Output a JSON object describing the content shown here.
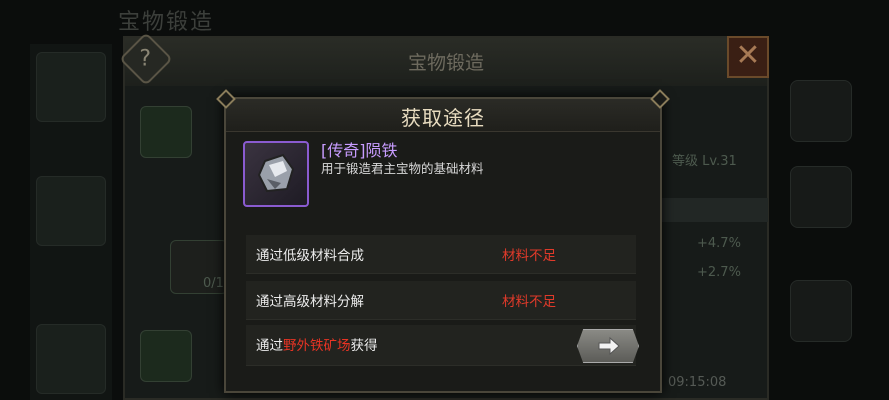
{
  "background": {
    "title": "宝物锻造",
    "panel_title": "宝物锻造",
    "help_label": "?",
    "close_label": "✕",
    "level_text": "等级 Lv.31",
    "stats": [
      "+4.7%",
      "+2.7%"
    ],
    "count_text": "0/1",
    "time": "09:15:08"
  },
  "dialog": {
    "title": "获取途径",
    "item": {
      "name": "[传奇]陨铁",
      "description": "用于锻造君主宝物的基础材料",
      "icon": "meteorite-icon"
    },
    "rows": [
      {
        "label": "通过低级材料合成",
        "status": "材料不足"
      },
      {
        "label": "通过高级材料分解",
        "status": "材料不足"
      }
    ],
    "row3": {
      "prefix": "通过",
      "highlight": "野外铁矿场",
      "suffix": "获得"
    },
    "go_icon": "arrow-right-icon"
  },
  "colors": {
    "legendary": "#c89cff",
    "warning": "#e03a2a",
    "title": "#e8dcc0"
  }
}
